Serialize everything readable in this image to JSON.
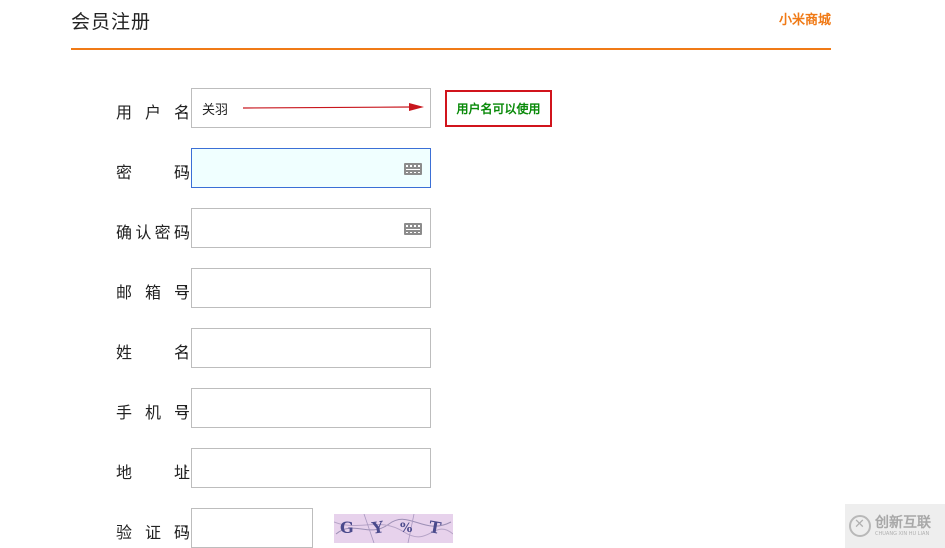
{
  "header": {
    "title": "会员注册",
    "brand_link": "小米商城",
    "accent_color": "#f07a16"
  },
  "form": {
    "username": {
      "label": "用 户 名",
      "colon": ":",
      "value": "关羽",
      "status": "用户名可以使用",
      "status_color": "#0a8a0a",
      "status_border_color": "#d1141c"
    },
    "password": {
      "label": "密    码",
      "colon": ":",
      "value": "",
      "icon": "keyboard-icon"
    },
    "confirm_password": {
      "label": "确认密码",
      "colon": ":",
      "value": "",
      "icon": "keyboard-icon"
    },
    "email": {
      "label": "邮 箱 号",
      "colon": ":",
      "value": ""
    },
    "name": {
      "label": "姓    名",
      "colon": ":",
      "value": ""
    },
    "phone": {
      "label": "手 机 号",
      "colon": ":",
      "value": ""
    },
    "address": {
      "label": "地    址",
      "colon": ":",
      "value": ""
    },
    "captcha": {
      "label": "验 证 码",
      "colon": ":",
      "value": "",
      "image_chars": [
        "G",
        "Y",
        "%",
        "T"
      ]
    }
  },
  "watermark": {
    "main": "创新互联",
    "sub": "CHUANG XIN HU LIAN"
  }
}
